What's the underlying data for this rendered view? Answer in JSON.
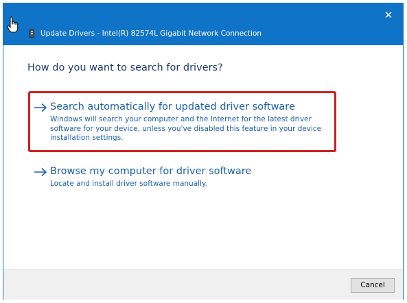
{
  "window": {
    "title": "Update Drivers - Intel(R) 82574L Gigabit Network Connection",
    "close_glyph": "✕",
    "title_icon": "network-driver-icon"
  },
  "main": {
    "heading": "How do you want to search for drivers?",
    "options": [
      {
        "title": "Search automatically for updated driver software",
        "description": "Windows will search your computer and the Internet for the latest driver software for your device, unless you've disabled this feature in your device installation settings.",
        "icon": "arrow-right-icon",
        "highlighted": true
      },
      {
        "title": "Browse my computer for driver software",
        "description": "Locate and install driver software manually.",
        "icon": "arrow-right-icon",
        "highlighted": false
      }
    ]
  },
  "footer": {
    "cancel_label": "Cancel"
  },
  "colors": {
    "titlebar": "#0f73c7",
    "link": "#1c5fa8",
    "highlight_border": "#c9211e"
  }
}
